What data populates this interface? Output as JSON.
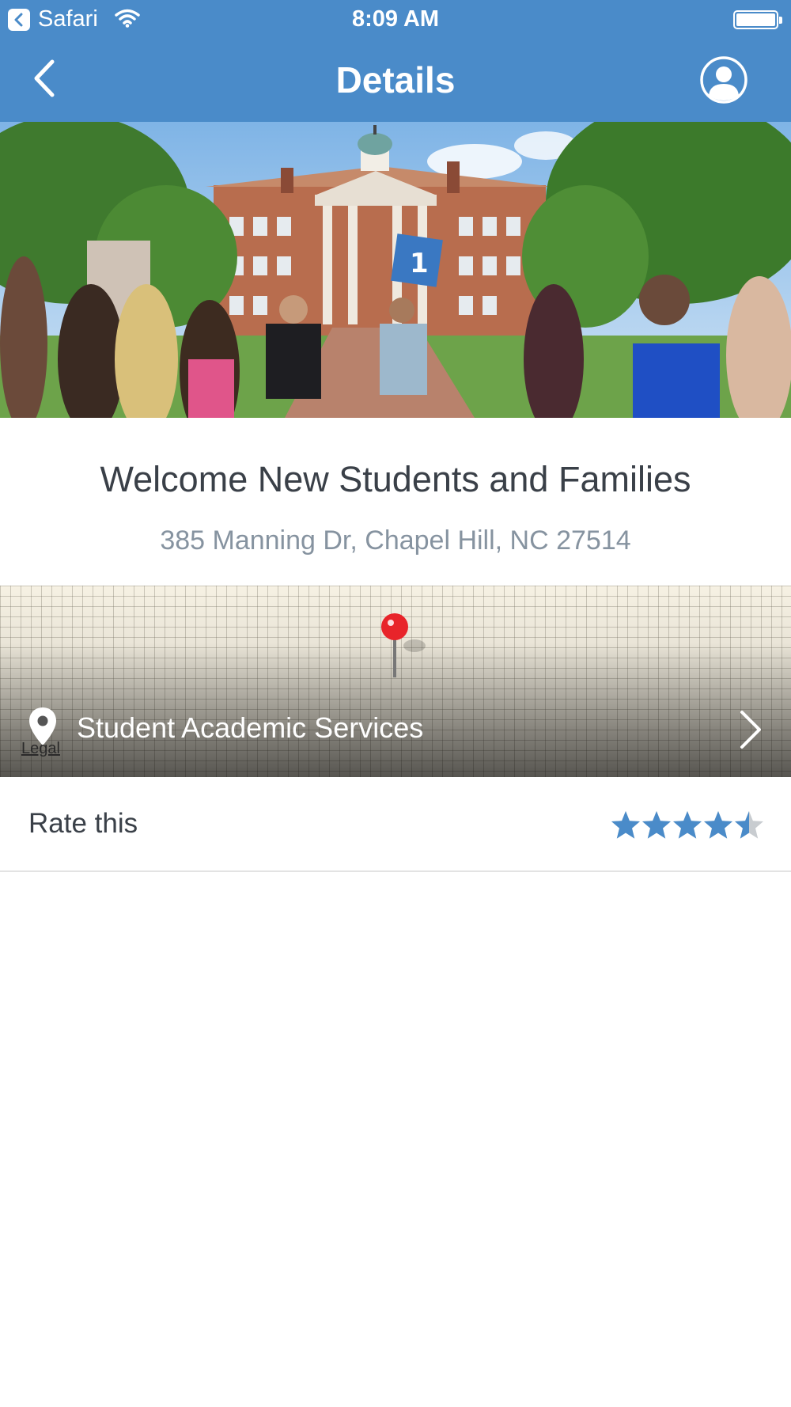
{
  "status_bar": {
    "back_app": "Safari",
    "time": "8:09 AM"
  },
  "nav": {
    "title": "Details"
  },
  "event": {
    "title": "Welcome New Students and Families",
    "address": "385 Manning Dr, Chapel Hill, NC 27514"
  },
  "hero": {
    "flag_number": "1"
  },
  "map": {
    "place_name": "Student Academic Services",
    "legal_label": "Legal"
  },
  "rating": {
    "label": "Rate this",
    "value": 4.5,
    "max": 5
  },
  "colors": {
    "brand_blue": "#4a8bc9",
    "star_blue": "#4a8bc9",
    "star_empty": "#c8ccd0",
    "pin_red": "#e8242a"
  }
}
